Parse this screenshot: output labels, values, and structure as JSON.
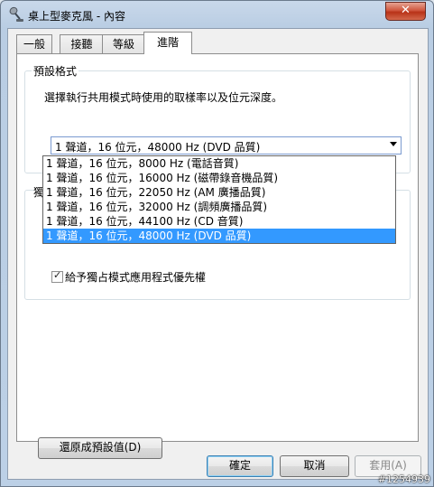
{
  "window": {
    "title": "桌上型麥克風 - 內容",
    "close_label": "✕"
  },
  "tabs": [
    {
      "label": "一般"
    },
    {
      "label": "接聽"
    },
    {
      "label": "等級"
    },
    {
      "label": "進階"
    }
  ],
  "default_format": {
    "group_title": "預設格式",
    "description": "選擇執行共用模式時使用的取樣率以及位元深度。",
    "selected": "1 聲道，16 位元，48000 Hz (DVD 品質)",
    "options": [
      "1 聲道，16 位元，8000 Hz (電話音質)",
      "1 聲道，16 位元，16000 Hz (磁帶錄音機品質)",
      "1 聲道，16 位元，22050 Hz (AM 廣播品質)",
      "1 聲道，16 位元，32000 Hz (調頻廣播品質)",
      "1 聲道，16 位元，44100 Hz (CD 音質)",
      "1 聲道，16 位元，48000 Hz (DVD 品質)"
    ]
  },
  "exclusive_mode": {
    "group_title_partial": "獨",
    "priority_checkbox_label": "給予獨占模式應用程式優先權",
    "priority_checked": true
  },
  "buttons": {
    "restore_defaults": "還原成預設值(D)",
    "ok": "確定",
    "cancel": "取消",
    "apply": "套用(A)"
  },
  "watermark": "#1254939"
}
